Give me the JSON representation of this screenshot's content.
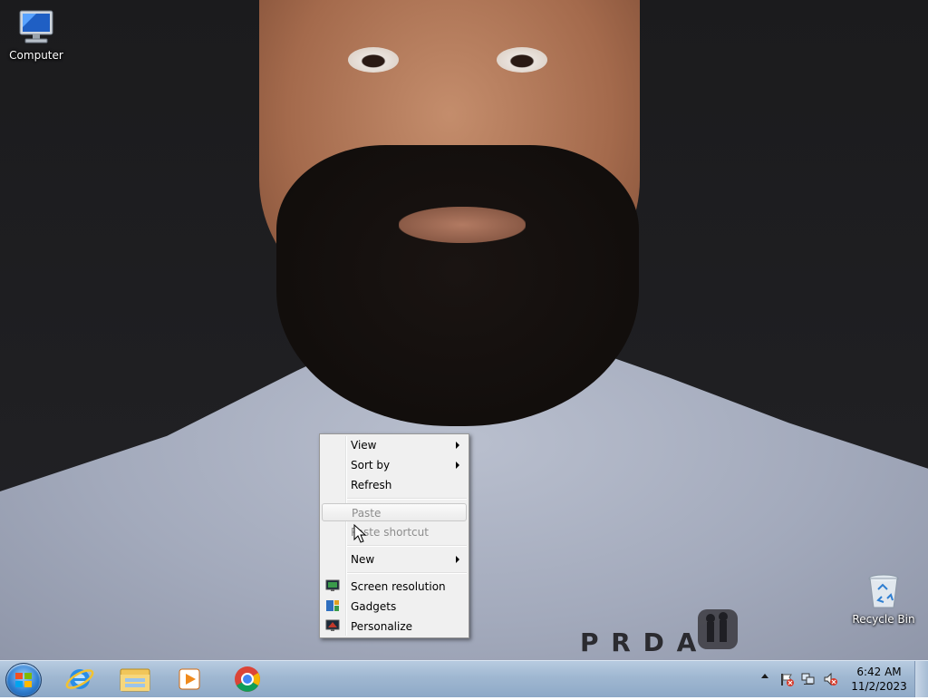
{
  "desktop": {
    "icons": [
      {
        "label": "Computer",
        "icon": "computer-icon"
      },
      {
        "label": "Recycle Bin",
        "icon": "recycle-bin-icon"
      }
    ],
    "wallpaper_text": "P R  D A"
  },
  "context_menu": {
    "items": [
      {
        "label": "View",
        "submenu": true,
        "enabled": true
      },
      {
        "label": "Sort by",
        "submenu": true,
        "enabled": true
      },
      {
        "label": "Refresh",
        "submenu": false,
        "enabled": true
      },
      {
        "label": "Paste",
        "submenu": false,
        "enabled": false,
        "highlighted": true
      },
      {
        "label": "Paste shortcut",
        "submenu": false,
        "enabled": false
      },
      {
        "label": "New",
        "submenu": true,
        "enabled": true
      },
      {
        "label": "Screen resolution",
        "icon": "monitor-icon",
        "enabled": true
      },
      {
        "label": "Gadgets",
        "icon": "gadgets-icon",
        "enabled": true
      },
      {
        "label": "Personalize",
        "icon": "personalize-icon",
        "enabled": true
      }
    ]
  },
  "taskbar": {
    "start": "start-orb",
    "pinned": [
      "internet-explorer-icon",
      "file-explorer-icon",
      "media-player-icon",
      "chrome-icon"
    ],
    "tray": {
      "icons": [
        "show-hidden-icons-chevron",
        "action-center-flag-icon",
        "network-icon",
        "volume-muted-icon"
      ],
      "time": "6:42 AM",
      "date": "11/2/2023"
    }
  },
  "colors": {
    "taskbar": "#9fb7d1",
    "menu_bg": "#f0f0f0",
    "disabled_text": "#8d8d8d"
  }
}
